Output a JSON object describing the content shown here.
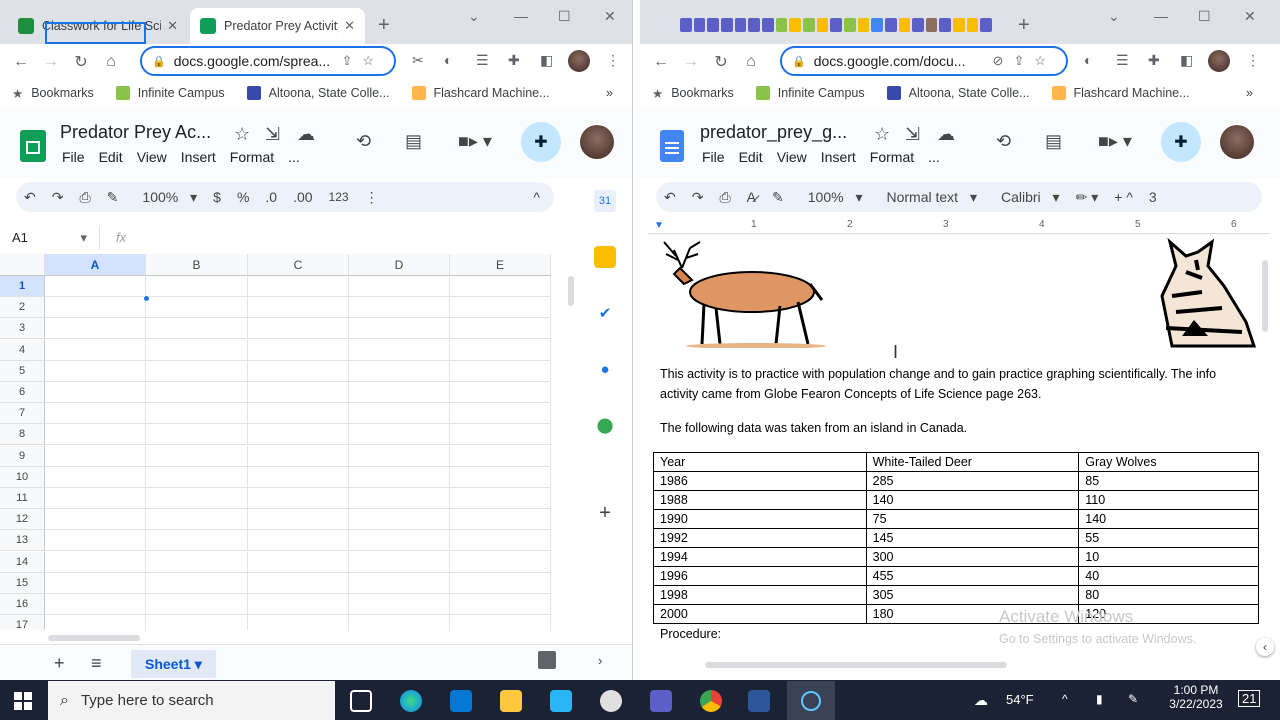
{
  "left_window": {
    "tabs": [
      {
        "label": "Classwork for Life Sci",
        "close": "✕"
      },
      {
        "label": "Predator Prey Activity",
        "close": "✕"
      }
    ],
    "new_tab": "+",
    "url": "docs.google.com/sprea...",
    "bookmarks": [
      "Bookmarks",
      "Infinite Campus",
      "Altoona, State Colle...",
      "Flashcard Machine..."
    ],
    "bookmarks_more": "»",
    "app_title": "Predator Prey Ac...",
    "menus": [
      "File",
      "Edit",
      "View",
      "Insert",
      "Format",
      "..."
    ],
    "toolbar": {
      "zoom": "100%",
      "currency": "$",
      "percent": "%",
      "dec_less": ".0",
      "dec_more": ".00",
      "number_format": "123"
    },
    "name_box": "A1",
    "fx": "fx",
    "columns": [
      "A",
      "B",
      "C",
      "D",
      "E"
    ],
    "rows": [
      "1",
      "2",
      "3",
      "4",
      "5",
      "6",
      "7",
      "8",
      "9",
      "10",
      "11",
      "12",
      "13",
      "14",
      "15",
      "16",
      "17"
    ],
    "sheet_tab": "Sheet1",
    "add_sheet": "+",
    "all_sheets": "≡"
  },
  "right_window": {
    "new_tab": "+",
    "url": "docs.google.com/docu...",
    "bookmarks": [
      "Bookmarks",
      "Infinite Campus",
      "Altoona, State Colle...",
      "Flashcard Machine..."
    ],
    "bookmarks_more": "»",
    "app_title": "predator_prey_g...",
    "menus": [
      "File",
      "Edit",
      "View",
      "Insert",
      "Format",
      "..."
    ],
    "toolbar": {
      "zoom": "100%",
      "style": "Normal text",
      "font": "Calibri",
      "more": "3"
    },
    "ruler": [
      "1",
      "2",
      "3",
      "4",
      "5",
      "6"
    ],
    "intro_line1": "This activity is to practice with population change and to gain practice graphing scientifically.  The info",
    "intro_line2": "activity came from Globe Fearon Concepts of Life Science page 263.",
    "data_line": "The following data was taken from an island in Canada.",
    "table": {
      "headers": [
        "Year",
        "White-Tailed Deer",
        "Gray Wolves"
      ],
      "rows": [
        [
          "1986",
          "285",
          "85"
        ],
        [
          "1988",
          "140",
          "110"
        ],
        [
          "1990",
          "75",
          "140"
        ],
        [
          "1992",
          "145",
          "55"
        ],
        [
          "1994",
          "300",
          "10"
        ],
        [
          "1996",
          "455",
          "40"
        ],
        [
          "1998",
          "305",
          "80"
        ],
        [
          "2000",
          "180",
          "120"
        ]
      ]
    },
    "procedure": "Procedure:",
    "watermark_title": "Activate Windows",
    "watermark_sub": "Go to Settings to activate Windows."
  },
  "taskbar": {
    "search_placeholder": "Type here to search",
    "weather": "54°F",
    "time": "1:00 PM",
    "date": "3/22/2023",
    "notifications": "21"
  }
}
